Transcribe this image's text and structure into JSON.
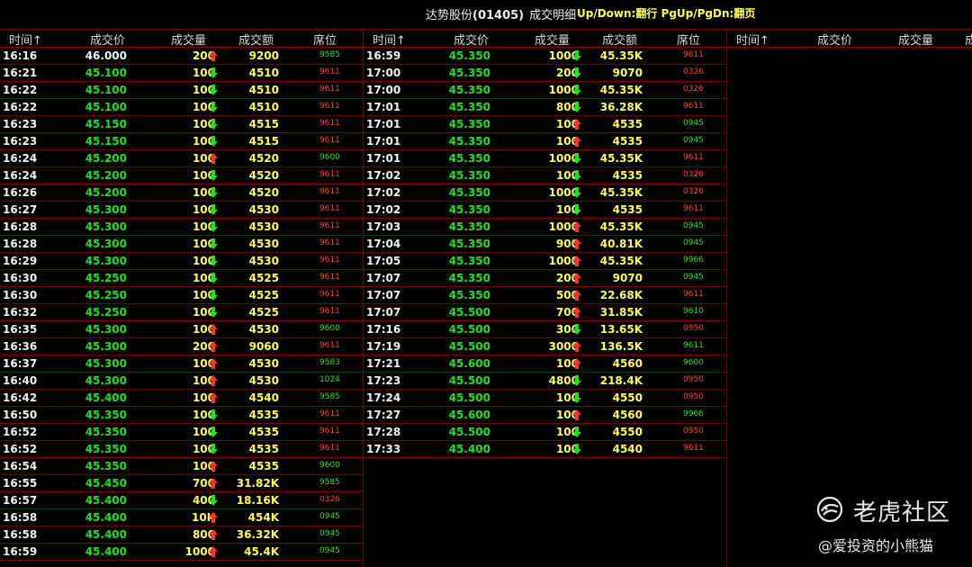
{
  "title": {
    "stock": "达势股份",
    "code": "(01405)",
    "subtitle": "成交明细",
    "hint": "Up/Down:翻行 PgUp/PgDn:翻页"
  },
  "headers": {
    "time": "时间↑",
    "price": "成交价",
    "volume": "成交量",
    "amount": "成交额",
    "seat": "席位"
  },
  "colors": {
    "up": "#ff3030",
    "down": "#22e022",
    "volume": "#ffff55",
    "grid": "#7a0000"
  },
  "panels": [
    {
      "rows": [
        {
          "time": "16:16",
          "price": "46.000",
          "pc": "neutral",
          "vol": "200",
          "dir": "up",
          "amt": "9200",
          "seat": "9585",
          "sc": "green"
        },
        {
          "time": "16:21",
          "price": "45.100",
          "pc": "down",
          "vol": "100",
          "dir": "down",
          "amt": "4510",
          "seat": "9611",
          "sc": "red"
        },
        {
          "time": "16:22",
          "price": "45.100",
          "pc": "down",
          "vol": "100",
          "dir": "down",
          "amt": "4510",
          "seat": "9611",
          "sc": "red"
        },
        {
          "time": "16:22",
          "price": "45.100",
          "pc": "down",
          "vol": "100",
          "dir": "down",
          "amt": "4510",
          "seat": "9611",
          "sc": "red"
        },
        {
          "time": "16:23",
          "price": "45.150",
          "pc": "down",
          "vol": "100",
          "dir": "down",
          "amt": "4515",
          "seat": "9611",
          "sc": "red"
        },
        {
          "time": "16:23",
          "price": "45.150",
          "pc": "down",
          "vol": "100",
          "dir": "down",
          "amt": "4515",
          "seat": "9611",
          "sc": "red"
        },
        {
          "time": "16:24",
          "price": "45.200",
          "pc": "down",
          "vol": "100",
          "dir": "up",
          "amt": "4520",
          "seat": "9600",
          "sc": "green"
        },
        {
          "time": "16:24",
          "price": "45.200",
          "pc": "down",
          "vol": "100",
          "dir": "down",
          "amt": "4520",
          "seat": "9611",
          "sc": "red"
        },
        {
          "time": "16:26",
          "price": "45.200",
          "pc": "down",
          "vol": "100",
          "dir": "down",
          "amt": "4520",
          "seat": "9611",
          "sc": "red"
        },
        {
          "time": "16:27",
          "price": "45.300",
          "pc": "down",
          "vol": "100",
          "dir": "down",
          "amt": "4530",
          "seat": "9611",
          "sc": "red"
        },
        {
          "time": "16:28",
          "price": "45.300",
          "pc": "down",
          "vol": "100",
          "dir": "down",
          "amt": "4530",
          "seat": "9611",
          "sc": "red"
        },
        {
          "time": "16:28",
          "price": "45.300",
          "pc": "down",
          "vol": "100",
          "dir": "down",
          "amt": "4530",
          "seat": "9611",
          "sc": "red"
        },
        {
          "time": "16:29",
          "price": "45.300",
          "pc": "down",
          "vol": "100",
          "dir": "down",
          "amt": "4530",
          "seat": "9611",
          "sc": "red"
        },
        {
          "time": "16:30",
          "price": "45.250",
          "pc": "down",
          "vol": "100",
          "dir": "down",
          "amt": "4525",
          "seat": "9611",
          "sc": "red"
        },
        {
          "time": "16:30",
          "price": "45.250",
          "pc": "down",
          "vol": "100",
          "dir": "down",
          "amt": "4525",
          "seat": "9611",
          "sc": "red"
        },
        {
          "time": "16:32",
          "price": "45.250",
          "pc": "down",
          "vol": "100",
          "dir": "down",
          "amt": "4525",
          "seat": "9611",
          "sc": "red"
        },
        {
          "time": "16:35",
          "price": "45.300",
          "pc": "down",
          "vol": "100",
          "dir": "up",
          "amt": "4530",
          "seat": "9600",
          "sc": "green"
        },
        {
          "time": "16:36",
          "price": "45.300",
          "pc": "down",
          "vol": "200",
          "dir": "up",
          "amt": "9060",
          "seat": "9611",
          "sc": "red"
        },
        {
          "time": "16:37",
          "price": "45.300",
          "pc": "down",
          "vol": "100",
          "dir": "up",
          "amt": "4530",
          "seat": "9583",
          "sc": "green"
        },
        {
          "time": "16:40",
          "price": "45.300",
          "pc": "down",
          "vol": "100",
          "dir": "up",
          "amt": "4530",
          "seat": "1024",
          "sc": "green"
        },
        {
          "time": "16:42",
          "price": "45.400",
          "pc": "down",
          "vol": "100",
          "dir": "up",
          "amt": "4540",
          "seat": "9585",
          "sc": "green"
        },
        {
          "time": "16:50",
          "price": "45.350",
          "pc": "down",
          "vol": "100",
          "dir": "down",
          "amt": "4535",
          "seat": "9611",
          "sc": "red"
        },
        {
          "time": "16:52",
          "price": "45.350",
          "pc": "down",
          "vol": "100",
          "dir": "down",
          "amt": "4535",
          "seat": "9611",
          "sc": "red"
        },
        {
          "time": "16:52",
          "price": "45.350",
          "pc": "down",
          "vol": "100",
          "dir": "down",
          "amt": "4535",
          "seat": "9611",
          "sc": "red"
        },
        {
          "time": "16:54",
          "price": "45.350",
          "pc": "down",
          "vol": "100",
          "dir": "up",
          "amt": "4535",
          "seat": "9600",
          "sc": "green"
        },
        {
          "time": "16:55",
          "price": "45.450",
          "pc": "down",
          "vol": "700",
          "dir": "up",
          "amt": "31.82K",
          "seat": "9585",
          "sc": "green"
        },
        {
          "time": "16:57",
          "price": "45.400",
          "pc": "down",
          "vol": "400",
          "dir": "down",
          "amt": "18.16K",
          "seat": "0326",
          "sc": "red"
        },
        {
          "time": "16:58",
          "price": "45.400",
          "pc": "down",
          "vol": "10K",
          "dir": "up",
          "amt": "454K",
          "seat": "0945",
          "sc": "green"
        },
        {
          "time": "16:58",
          "price": "45.400",
          "pc": "down",
          "vol": "800",
          "dir": "up",
          "amt": "36.32K",
          "seat": "0945",
          "sc": "green"
        },
        {
          "time": "16:59",
          "price": "45.400",
          "pc": "down",
          "vol": "1000",
          "dir": "up",
          "amt": "45.4K",
          "seat": "0945",
          "sc": "green"
        }
      ]
    },
    {
      "rows": [
        {
          "time": "16:59",
          "price": "45.350",
          "pc": "down",
          "vol": "1000",
          "dir": "down",
          "amt": "45.35K",
          "seat": "9611",
          "sc": "red"
        },
        {
          "time": "17:00",
          "price": "45.350",
          "pc": "down",
          "vol": "200",
          "dir": "down",
          "amt": "9070",
          "seat": "0326",
          "sc": "red"
        },
        {
          "time": "17:00",
          "price": "45.350",
          "pc": "down",
          "vol": "1000",
          "dir": "down",
          "amt": "45.35K",
          "seat": "0326",
          "sc": "red"
        },
        {
          "time": "17:01",
          "price": "45.350",
          "pc": "down",
          "vol": "800",
          "dir": "down",
          "amt": "36.28K",
          "seat": "9611",
          "sc": "red"
        },
        {
          "time": "17:01",
          "price": "45.350",
          "pc": "down",
          "vol": "100",
          "dir": "up",
          "amt": "4535",
          "seat": "0945",
          "sc": "green"
        },
        {
          "time": "17:01",
          "price": "45.350",
          "pc": "down",
          "vol": "100",
          "dir": "up",
          "amt": "4535",
          "seat": "0945",
          "sc": "green"
        },
        {
          "time": "17:01",
          "price": "45.350",
          "pc": "down",
          "vol": "1000",
          "dir": "down",
          "amt": "45.35K",
          "seat": "9611",
          "sc": "red"
        },
        {
          "time": "17:02",
          "price": "45.350",
          "pc": "down",
          "vol": "100",
          "dir": "down",
          "amt": "4535",
          "seat": "0326",
          "sc": "red"
        },
        {
          "time": "17:02",
          "price": "45.350",
          "pc": "down",
          "vol": "1000",
          "dir": "down",
          "amt": "45.35K",
          "seat": "0326",
          "sc": "red"
        },
        {
          "time": "17:02",
          "price": "45.350",
          "pc": "down",
          "vol": "100",
          "dir": "down",
          "amt": "4535",
          "seat": "9611",
          "sc": "red"
        },
        {
          "time": "17:03",
          "price": "45.350",
          "pc": "down",
          "vol": "1000",
          "dir": "up",
          "amt": "45.35K",
          "seat": "0945",
          "sc": "green"
        },
        {
          "time": "17:04",
          "price": "45.350",
          "pc": "down",
          "vol": "900",
          "dir": "up",
          "amt": "40.81K",
          "seat": "0945",
          "sc": "green"
        },
        {
          "time": "17:05",
          "price": "45.350",
          "pc": "down",
          "vol": "1000",
          "dir": "up",
          "amt": "45.35K",
          "seat": "9966",
          "sc": "green"
        },
        {
          "time": "17:07",
          "price": "45.350",
          "pc": "down",
          "vol": "200",
          "dir": "up",
          "amt": "9070",
          "seat": "0945",
          "sc": "green"
        },
        {
          "time": "17:07",
          "price": "45.350",
          "pc": "down",
          "vol": "500",
          "dir": "up",
          "amt": "22.68K",
          "seat": "9611",
          "sc": "red"
        },
        {
          "time": "17:07",
          "price": "45.500",
          "pc": "down",
          "vol": "700",
          "dir": "up",
          "amt": "31.85K",
          "seat": "9610",
          "sc": "green"
        },
        {
          "time": "17:16",
          "price": "45.500",
          "pc": "down",
          "vol": "300",
          "dir": "down",
          "amt": "13.65K",
          "seat": "0950",
          "sc": "red"
        },
        {
          "time": "17:19",
          "price": "45.500",
          "pc": "down",
          "vol": "3000",
          "dir": "up",
          "amt": "136.5K",
          "seat": "9611",
          "sc": "green"
        },
        {
          "time": "17:21",
          "price": "45.600",
          "pc": "down",
          "vol": "100",
          "dir": "up",
          "amt": "4560",
          "seat": "9600",
          "sc": "green"
        },
        {
          "time": "17:23",
          "price": "45.500",
          "pc": "down",
          "vol": "4800",
          "dir": "down",
          "amt": "218.4K",
          "seat": "0950",
          "sc": "red"
        },
        {
          "time": "17:24",
          "price": "45.500",
          "pc": "down",
          "vol": "100",
          "dir": "down",
          "amt": "4550",
          "seat": "0950",
          "sc": "red"
        },
        {
          "time": "17:27",
          "price": "45.600",
          "pc": "down",
          "vol": "100",
          "dir": "up",
          "amt": "4560",
          "seat": "9966",
          "sc": "green"
        },
        {
          "time": "17:28",
          "price": "45.500",
          "pc": "down",
          "vol": "100",
          "dir": "down",
          "amt": "4550",
          "seat": "0950",
          "sc": "red"
        },
        {
          "time": "17:33",
          "price": "45.400",
          "pc": "down",
          "vol": "100",
          "dir": "down",
          "amt": "4540",
          "seat": "9611",
          "sc": "red"
        }
      ]
    },
    {
      "rows": []
    }
  ],
  "watermark": {
    "brand": "老虎社区",
    "user": "@爱投资的小熊猫"
  }
}
